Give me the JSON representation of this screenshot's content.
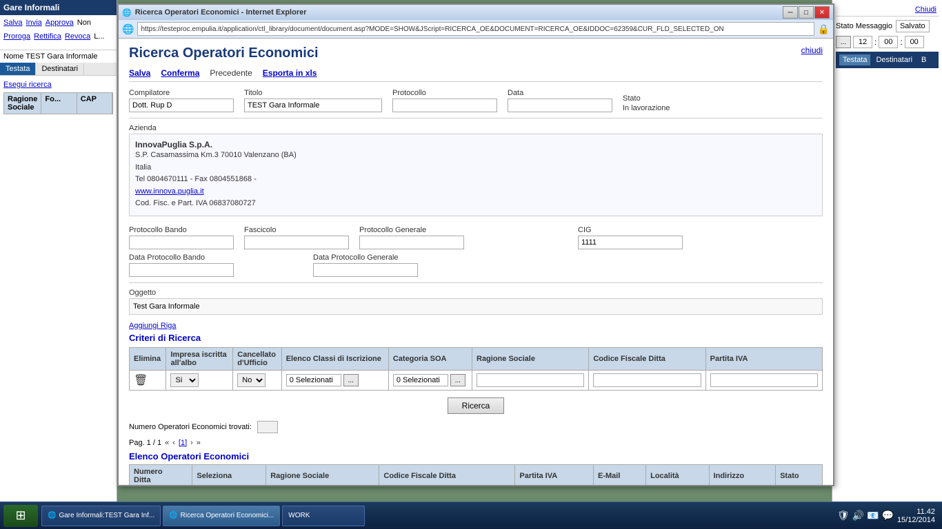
{
  "background_window": {
    "title": "Gare Informali:TEST Gara Inf...",
    "url_partial": "https://testeproc.empulia.it"
  },
  "ie_window": {
    "title": "Ricerca Operatori Economici - Internet Explorer",
    "address_bar": "https://testeproc.empulia.it/application/ctl_library/document/document.asp?MODE=SHOW&JScript=RICERCA_OE&DOCUMENT=RICERCA_OE&IDDOC=62359&CUR_FLD_SELECTED_ON"
  },
  "page": {
    "title": "Ricerca Operatori Economici",
    "close_label": "chiudi"
  },
  "toolbar": {
    "salva": "Salva",
    "conferma": "Conferma",
    "precedente": "Precedente",
    "esporta": "Esporta in xls"
  },
  "header_form": {
    "compilatore_label": "Compilatore",
    "compilatore_value": "Dott. Rup D",
    "titolo_label": "Titolo",
    "titolo_value": "TEST Gara Informale",
    "protocollo_label": "Protocollo",
    "protocollo_value": "",
    "data_label": "Data",
    "data_value": "",
    "stato_label": "Stato",
    "stato_value": "In lavorazione"
  },
  "azienda": {
    "label": "Azienda",
    "name": "InnovaPuglia S.p.A.",
    "address": "S.P. Casamassima Km.3 70010 Valenzano (BA)",
    "country": "Italia",
    "tel_fax": "Tel 0804670111 - Fax 0804551868 -",
    "website": "www.innova.puglia.it",
    "cod_fisc": "Cod. Fisc. e Part. IVA 06837080727"
  },
  "protocollo_section": {
    "protocollo_bando_label": "Protocollo Bando",
    "protocollo_bando_value": "",
    "fascicolo_label": "Fascicolo",
    "fascicolo_value": "",
    "protocollo_generale_label": "Protocollo Generale",
    "protocollo_generale_value": "",
    "cig_label": "CIG",
    "cig_value": "1111",
    "data_proto_bando_label": "Data Protocollo Bando",
    "data_proto_bando_value": "",
    "data_proto_generale_label": "Data Protocollo Generale",
    "data_proto_generale_value": ""
  },
  "oggetto": {
    "label": "Oggetto",
    "value": "Test Gara Informale"
  },
  "criteri": {
    "aggiungi_link": "Aggiungi Riga",
    "title": "Criteri di Ricerca",
    "columns": {
      "elimina": "Elimina",
      "impresa_iscritta": "Impresa iscritta all'albo",
      "cancellato": "Cancellato d'Ufficio",
      "elenco_classi": "Elenco Classi di Iscrizione",
      "categoria_soa": "Categoria SOA",
      "ragione_sociale": "Ragione Sociale",
      "codice_fiscale": "Codice Fiscale Ditta",
      "partita_iva": "Partita IVA"
    },
    "row": {
      "impresa_options": [
        "Si",
        "No"
      ],
      "impresa_selected": "Si",
      "cancellato_options": [
        "No",
        "Si"
      ],
      "cancellato_selected": "No",
      "elenco_classi_value": "0 Selezionati",
      "categoria_soa_value": "0 Selezionati",
      "ragione_sociale_value": "",
      "codice_fiscale_value": "",
      "partita_iva_value": ""
    }
  },
  "ricerca_button": "Ricerca",
  "numero_trovati": {
    "label": "Numero Operatori Economici trovati:",
    "value": ""
  },
  "pagination": {
    "label": "Pag. 1 / 1",
    "current": "[1]"
  },
  "elenco": {
    "title": "Elenco Operatori Economici",
    "columns": [
      "Numero Ditta",
      "Seleziona",
      "Ragione Sociale",
      "Codice Fiscale Ditta",
      "Partita IVA",
      "E-Mail",
      "Località",
      "Indirizzo",
      "Stato"
    ]
  },
  "right_panel": {
    "chiudi": "Chiudi",
    "stato_label": "Stato Messaggio",
    "stato_value": "Salvato",
    "hour": "12",
    "minute": "00",
    "second": "00",
    "browse_btn": "...",
    "tabs": [
      "Testata",
      "Destinatari",
      "B"
    ]
  },
  "left_panel": {
    "title": "Gare Informali",
    "nav_links": [
      "Salva",
      "Invia",
      "Approva",
      "Non",
      "Proroga",
      "Rettifica",
      "Revoca",
      "L..."
    ],
    "name_label": "Nome",
    "name_value": "TEST Gara Informale",
    "tabs": [
      "Testata",
      "Destinatari"
    ],
    "esegui_label": "Esegui ricerca",
    "table_cols": [
      "Ragione Sociale",
      "Fo...",
      "CAP"
    ]
  },
  "taskbar": {
    "clock_time": "11.42",
    "clock_date": "15/12/2014",
    "items": [
      {
        "label": "Gare Informali:TEST Gara Inf...",
        "active": false
      },
      {
        "label": "Ricerca Operatori Economici...",
        "active": true
      }
    ]
  }
}
